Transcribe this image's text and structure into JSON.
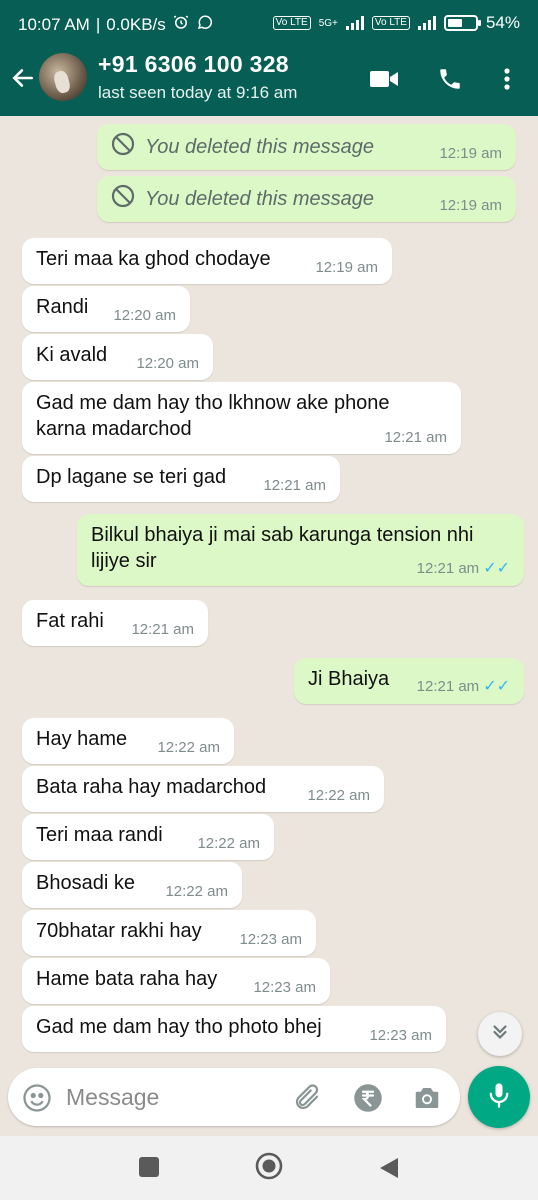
{
  "status_bar": {
    "time": "10:07 AM",
    "data_speed": "0.0KB/s",
    "network_labels": [
      "Vo LTE",
      "5G+",
      "Vo LTE"
    ],
    "battery": "54%"
  },
  "header": {
    "contact": "+91 6306 100 328",
    "last_seen": "last seen today at 9:16 am",
    "icons": [
      "back-arrow-icon",
      "video-call-icon",
      "voice-call-icon",
      "more-options-icon"
    ]
  },
  "messages": [
    {
      "dir": "out",
      "text": "You deleted this message",
      "time": "12:19 am",
      "deleted": true
    },
    {
      "dir": "out",
      "text": "You deleted this message",
      "time": "12:19 am",
      "deleted": true
    },
    {
      "dir": "in",
      "text": "Teri maa ka ghod chodaye",
      "time": "12:19 am"
    },
    {
      "dir": "in",
      "text": "Randi",
      "time": "12:20 am"
    },
    {
      "dir": "in",
      "text": "Ki avald",
      "time": "12:20 am"
    },
    {
      "dir": "in",
      "text": "Gad me dam hay tho lkhnow ake phone karna madarchod",
      "time": "12:21 am"
    },
    {
      "dir": "in",
      "text": "Dp lagane se teri gad",
      "time": "12:21 am"
    },
    {
      "dir": "out",
      "text": "Bilkul bhaiya ji mai sab karunga tension nhi lijiye sir",
      "time": "12:21 am",
      "read": true
    },
    {
      "dir": "in",
      "text": "Fat rahi",
      "time": "12:21 am"
    },
    {
      "dir": "out",
      "text": "Ji Bhaiya",
      "time": "12:21 am",
      "read": true
    },
    {
      "dir": "in",
      "text": "Hay hame",
      "time": "12:22 am"
    },
    {
      "dir": "in",
      "text": "Bata raha hay madarchod",
      "time": "12:22 am"
    },
    {
      "dir": "in",
      "text": "Teri maa randi",
      "time": "12:22 am"
    },
    {
      "dir": "in",
      "text": "Bhosadi ke",
      "time": "12:22 am"
    },
    {
      "dir": "in",
      "text": "70bhatar rakhi hay",
      "time": "12:23 am"
    },
    {
      "dir": "in",
      "text": "Hame bata raha hay",
      "time": "12:23 am"
    },
    {
      "dir": "in",
      "text": "Gad me dam hay tho photo bhej",
      "time": "12:23 am"
    }
  ],
  "composer": {
    "placeholder": "Message",
    "value": ""
  },
  "colors": {
    "header": "#075e54",
    "outgoing_bubble": "#dcf8c6",
    "incoming_bubble": "#ffffff",
    "chat_background": "#ece5dd",
    "mic_button": "#00a884",
    "read_ticks": "#34b7f1"
  }
}
